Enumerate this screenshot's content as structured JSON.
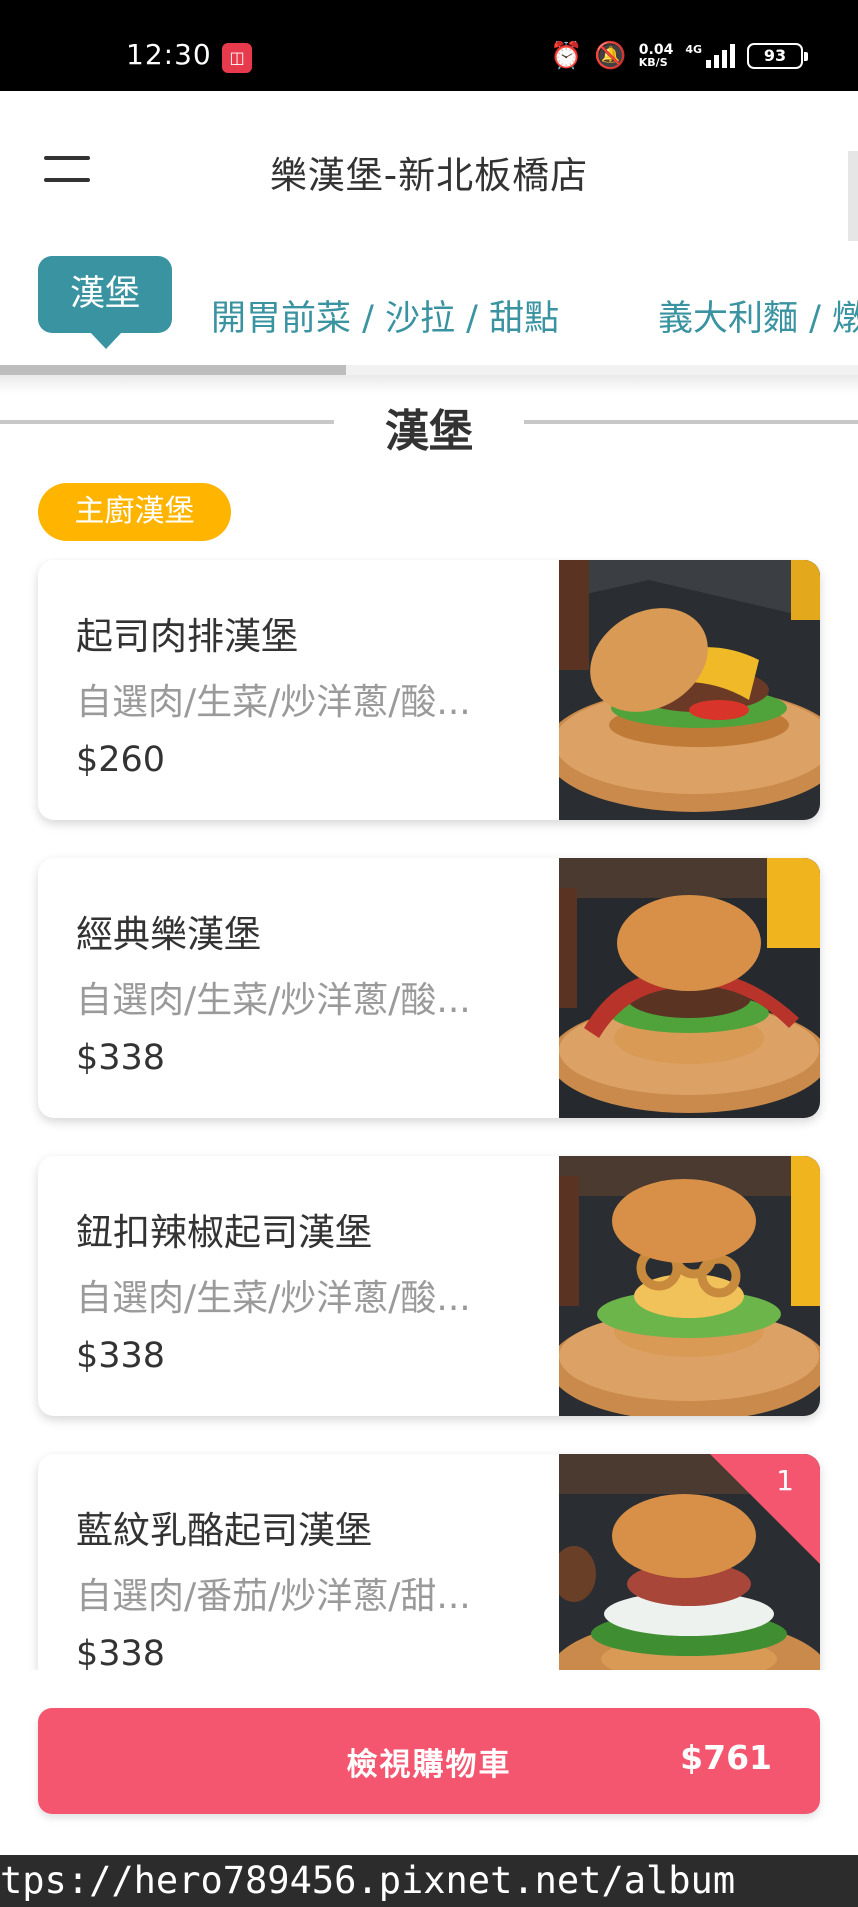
{
  "status_bar": {
    "time": "12:30",
    "net_speed": "0.04",
    "net_unit": "KB/S",
    "network_type": "4G",
    "battery": "93"
  },
  "header": {
    "store_title": "樂漢堡-新北板橋店"
  },
  "tabs": [
    {
      "label": "漢堡",
      "active": true
    },
    {
      "label": "開胃前菜 / 沙拉 / 甜點",
      "active": false
    },
    {
      "label": "義大利麵 / 燉",
      "active": false
    }
  ],
  "section": {
    "title": "漢堡",
    "badge": "主廚漢堡"
  },
  "menu_items": [
    {
      "name": "起司肉排漢堡",
      "description": "自選肉/生菜/炒洋蔥/酸...",
      "price": "$260",
      "image": "cheeseburger-photo"
    },
    {
      "name": "經典樂漢堡",
      "description": "自選肉/生菜/炒洋蔥/酸...",
      "price": "$338",
      "image": "bacon-burger-photo"
    },
    {
      "name": "鈕扣辣椒起司漢堡",
      "description": "自選肉/生菜/炒洋蔥/酸...",
      "price": "$338",
      "image": "onion-ring-burger-photo"
    },
    {
      "name": "藍紋乳酪起司漢堡",
      "description": "自選肉/番茄/炒洋蔥/甜...",
      "price": "$338",
      "image": "blue-cheese-burger-photo",
      "cart_quantity": "1"
    }
  ],
  "cart": {
    "label": "檢視購物車",
    "total": "$761"
  },
  "watermark": "tps://hero789456.pixnet.net/album",
  "colors": {
    "teal": "#3a93a1",
    "badge_yellow": "#ffb400",
    "cart_pink": "#f5566f"
  }
}
